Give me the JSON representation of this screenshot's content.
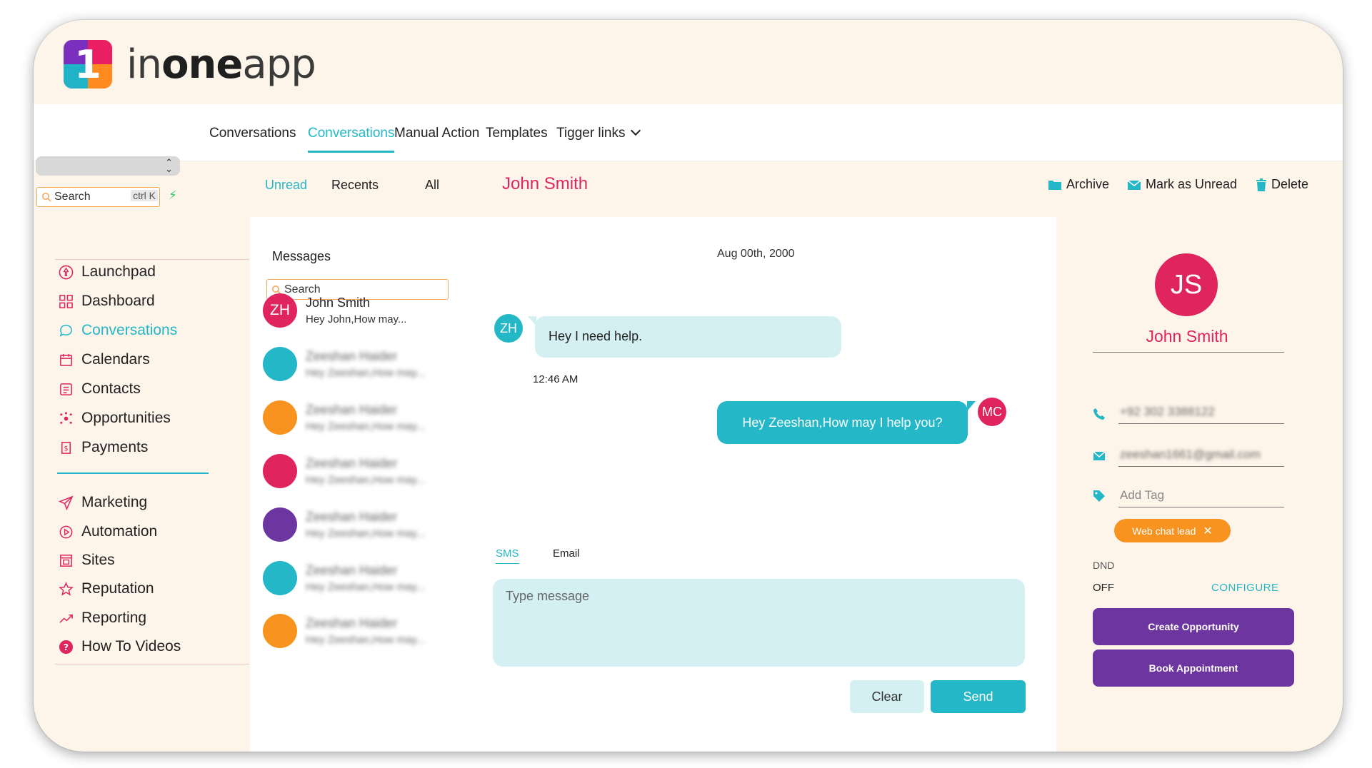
{
  "app": {
    "name_light": "in",
    "name_bold": "one",
    "name_end": "app",
    "logo_digit": "1"
  },
  "topnav": {
    "items": [
      "Conversations",
      "Conversations",
      "Manual Action",
      "Templates",
      "Tigger links"
    ],
    "active_index": 1
  },
  "sidebar": {
    "search_placeholder": "Search",
    "search_shortcut": "ctrl K",
    "items": [
      {
        "label": "Launchpad",
        "icon": "rocket-icon"
      },
      {
        "label": "Dashboard",
        "icon": "grid-icon"
      },
      {
        "label": "Conversations",
        "icon": "chat-icon"
      },
      {
        "label": "Calendars",
        "icon": "calendar-icon"
      },
      {
        "label": "Contacts",
        "icon": "contacts-icon"
      },
      {
        "label": "Opportunities",
        "icon": "opportunities-icon"
      },
      {
        "label": "Payments",
        "icon": "payments-icon"
      }
    ],
    "items2": [
      {
        "label": "Marketing",
        "icon": "send-icon"
      },
      {
        "label": "Automation",
        "icon": "automation-icon"
      },
      {
        "label": "Sites",
        "icon": "sites-icon"
      },
      {
        "label": "Reputation",
        "icon": "star-icon"
      },
      {
        "label": "Reporting",
        "icon": "trend-icon"
      },
      {
        "label": "How To Videos",
        "icon": "help-icon"
      }
    ],
    "active": "Conversations"
  },
  "subtabs": [
    "Unread",
    "Recents",
    "All"
  ],
  "contact_title": "John Smith",
  "actions": {
    "archive": "Archive",
    "mark_unread": "Mark as Unread",
    "delete": "Delete"
  },
  "list": {
    "title": "Messages",
    "search_placeholder": "Search",
    "conversations": [
      {
        "initials": "ZH",
        "name": "John Smith",
        "preview": "Hey John,How may...",
        "color": "#e0245e"
      },
      {
        "initials": "",
        "name": "Zeeshan Haider",
        "preview": "Hey Zeeshan,How may...",
        "color": "#23b7c8"
      },
      {
        "initials": "",
        "name": "Zeeshan Haider",
        "preview": "Hey Zeeshan,How may...",
        "color": "#f7931e"
      },
      {
        "initials": "",
        "name": "Zeeshan Haider",
        "preview": "Hey Zeeshan,How may...",
        "color": "#e0245e"
      },
      {
        "initials": "",
        "name": "Zeeshan Haider",
        "preview": "Hey Zeeshan,How may...",
        "color": "#6d35a0"
      },
      {
        "initials": "",
        "name": "Zeeshan Haider",
        "preview": "Hey Zeeshan,How may...",
        "color": "#23b7c8"
      },
      {
        "initials": "",
        "name": "Zeeshan Haider",
        "preview": "Hey Zeeshan,How may...",
        "color": "#f7931e"
      }
    ]
  },
  "chat": {
    "date": "Aug 00th, 2000",
    "incoming": {
      "initials": "ZH",
      "text": "Hey I need help.",
      "time": "12:46 AM"
    },
    "outgoing": {
      "initials": "MC",
      "text": "Hey Zeeshan,How may I help you?"
    },
    "channels": [
      "SMS",
      "Email"
    ],
    "composer_placeholder": "Type message",
    "clear_label": "Clear",
    "send_label": "Send"
  },
  "contact": {
    "initials": "JS",
    "name": "John Smith",
    "phone": "+92 302 3388122",
    "email": "zeeshan1661@gmail.com",
    "tag_placeholder": "Add Tag",
    "tag": "Web chat lead",
    "dnd_label": "DND",
    "dnd_value": "OFF",
    "configure_label": "CONFIGURE",
    "create_opportunity": "Create Opportunity",
    "book_appointment": "Book Appointment"
  },
  "colors": {
    "accent": "#23b7c8",
    "brand_pink": "#e0245e",
    "purple": "#6d35a0",
    "orange": "#f7931e",
    "background": "#fdf5ea"
  }
}
